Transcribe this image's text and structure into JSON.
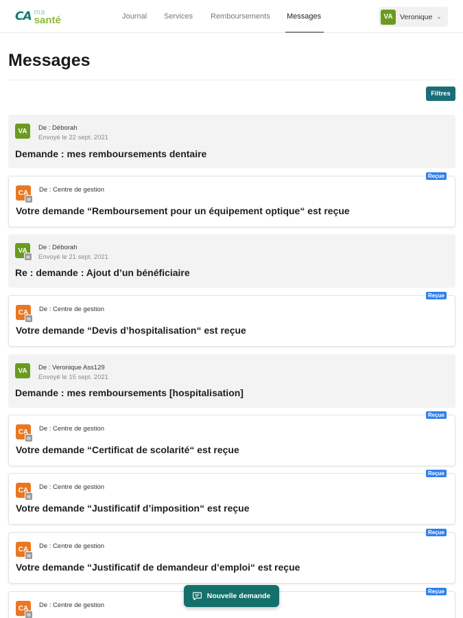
{
  "header": {
    "logo": {
      "ca": "CA",
      "ma": "ma",
      "sante": "santé"
    },
    "nav": [
      "Journal",
      "Services",
      "Remboursements",
      "Messages"
    ],
    "active_nav": "Messages",
    "user": {
      "initials": "VA",
      "name": "Veronique",
      "chevron": "⌄"
    },
    "colors": {
      "brand_green": "#6a9b1e",
      "teal": "#1a6e78",
      "orange": "#e97723",
      "badge_blue": "#2f80ed"
    }
  },
  "page": {
    "title": "Messages",
    "filter_label": "Filtres"
  },
  "messages": [
    {
      "type": "user",
      "avatar": "VA",
      "from": "De : Déborah",
      "date": "Envoyé le 22 sept. 2021",
      "subject": "Demande : mes remboursements dentaire",
      "badge": "",
      "mini_icon": false
    },
    {
      "type": "gestion",
      "avatar": "CA",
      "from": "De : Centre de gestion",
      "date": "",
      "subject": "Votre demande “Remboursement pour un équipement optique“ est reçue",
      "badge": "Reçue",
      "mini_icon": true
    },
    {
      "type": "user",
      "avatar": "VA",
      "from": "De : Déborah",
      "date": "Envoyé le 21 sept. 2021",
      "subject": "Re : demande : Ajout d’un bénéficiaire",
      "badge": "",
      "mini_icon": true
    },
    {
      "type": "gestion",
      "avatar": "CA",
      "from": "De : Centre de gestion",
      "date": "",
      "subject": "Votre demande “Devis d’hospitalisation“ est reçue",
      "badge": "Reçue",
      "mini_icon": true
    },
    {
      "type": "user",
      "avatar": "VA",
      "from": "De : Veronique Ass129",
      "date": "Envoyé le 15 sept. 2021",
      "subject": "Demande : mes remboursements [hospitalisation]",
      "badge": "",
      "mini_icon": false
    },
    {
      "type": "gestion",
      "avatar": "CA",
      "from": "De : Centre de gestion",
      "date": "",
      "subject": "Votre demande “Certificat de scolarité“ est reçue",
      "badge": "Reçue",
      "mini_icon": true
    },
    {
      "type": "gestion",
      "avatar": "CA",
      "from": "De : Centre de gestion",
      "date": "",
      "subject": "Votre demande “Justificatif d’imposition“ est reçue",
      "badge": "Reçue",
      "mini_icon": true
    },
    {
      "type": "gestion",
      "avatar": "CA",
      "from": "De : Centre de gestion",
      "date": "",
      "subject": "Votre demande “Justificatif de demandeur d’emploi“ est reçue",
      "badge": "Reçue",
      "mini_icon": true
    },
    {
      "type": "gestion",
      "avatar": "CA",
      "from": "De : Centre de gestion",
      "date": "",
      "subject": "",
      "badge": "Reçue",
      "mini_icon": true
    }
  ],
  "fab": {
    "label": "Nouvelle demande",
    "icon": "chat-bubble-icon"
  }
}
